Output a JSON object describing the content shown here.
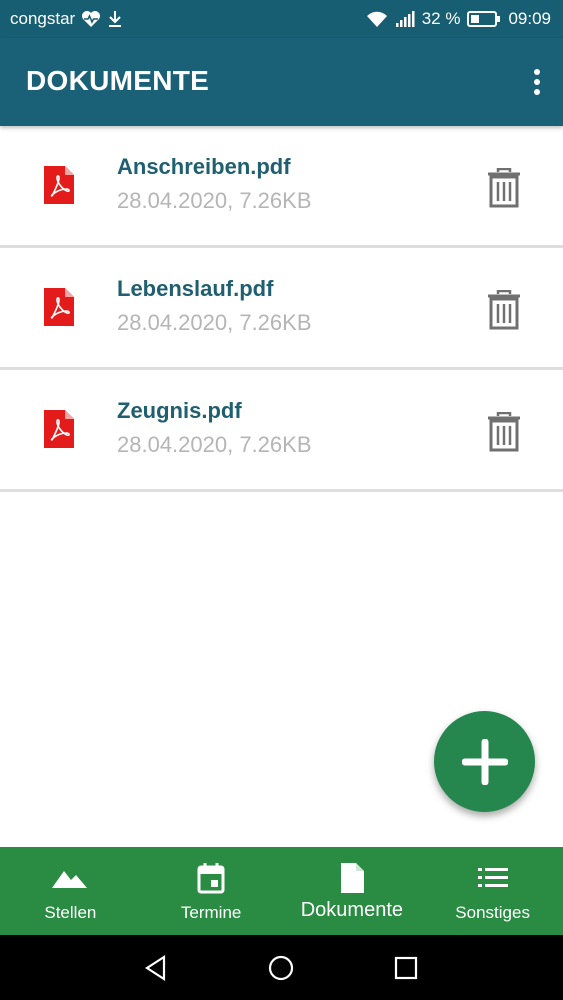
{
  "status_bar": {
    "carrier": "congstar",
    "battery_percent": "32 %",
    "time": "09:09"
  },
  "app_bar": {
    "title": "DOKUMENTE"
  },
  "documents": [
    {
      "name": "Anschreiben.pdf",
      "meta": "28.04.2020, 7.26KB"
    },
    {
      "name": "Lebenslauf.pdf",
      "meta": "28.04.2020, 7.26KB"
    },
    {
      "name": "Zeugnis.pdf",
      "meta": "28.04.2020, 7.26KB"
    }
  ],
  "bottom_nav": {
    "items": [
      {
        "label": "Stellen",
        "icon": "landscape-icon"
      },
      {
        "label": "Termine",
        "icon": "calendar-icon"
      },
      {
        "label": "Dokumente",
        "icon": "document-icon",
        "active": true
      },
      {
        "label": "Sonstiges",
        "icon": "list-icon"
      }
    ]
  },
  "colors": {
    "app_bar": "#1a6076",
    "bottom_nav": "#2a8b43",
    "fab": "#25874e",
    "pdf_red": "#e31b1b",
    "doc_name": "#1f5f70",
    "doc_meta": "#b5b5b5"
  }
}
